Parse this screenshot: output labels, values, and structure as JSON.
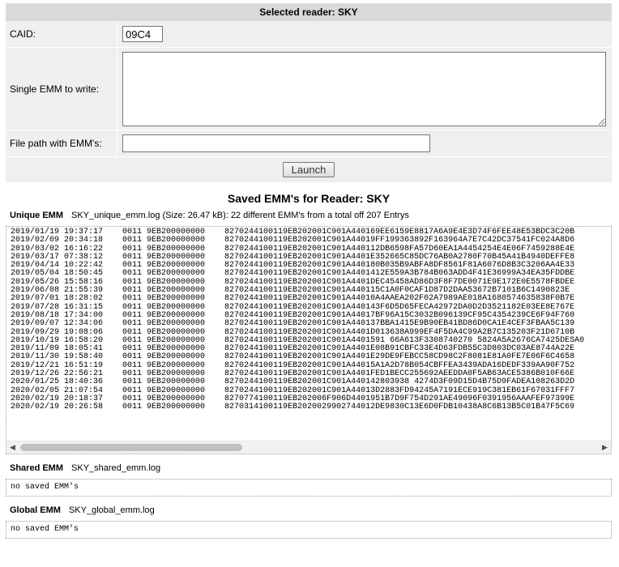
{
  "header": {
    "title": "Selected reader: SKY"
  },
  "form": {
    "caid_label": "CAID:",
    "caid_value": "09C4",
    "single_emm_label": "Single EMM to write:",
    "single_emm_value": "",
    "file_path_label": "File path with EMM's:",
    "file_path_value": "",
    "launch_label": "Launch"
  },
  "saved": {
    "title": "Saved EMM's for Reader: SKY",
    "unique": {
      "heading": "Unique EMM",
      "info": "SKY_unique_emm.log (Size: 26.47 kB): 22 different EMM's from a total off 207 Entrys",
      "lines": [
        "2019/01/19 19:37:17    0011 9EB200000000    8270244100119EB202001C901A440169EE6159E8817A6A9E4E3D74F6FEE48E53BDC3C20B",
        "2019/02/09 20:34:18    0011 9EB200000000    8270244100119EB202001C901A44019FF199363892F163964A7E7C42DC37541FC024A8D6",
        "2019/03/02 16:16:22    0011 9EB200000000    8270244100119EB202001C901A440112DB6598FA57D60EA1A4454254E4E06F7459288E4E",
        "2019/03/17 07:38:12    0011 9EB200000000    8270244100119EB202001C901A4401E352665C85DC76AB0A2780F70B45A41B4940DEFFE8",
        "2019/04/14 10:22:42    0011 9EB200000000    8270244100119EB202001C901A440180B035B9ABFA8DF8561F81A6076D8B3C3206AA4E33",
        "2019/05/04 18:50:45    0011 9EB200000000    8270244100119EB202001C901A4401412E559A3B784B063ADD4F41E36999A34EA35FDDBE",
        "2019/05/26 15:58:16    0011 9EB200000000    8270244100119EB202001C901A4401DEC45458AD86D3F8F7DE0071E9E172E0E5578FBDEE",
        "2019/06/08 21:55:39    0011 9EB200000000    8270244100119EB202001C901A440115C1A0F0CAF1D87D2DAA53672B7101B6C1490823E",
        "2019/07/01 18:28:02    0011 9EB200000000    8270244100119EB202001C901A44010A4AAEA202F02A7989AE018A1680574635838F0B7E",
        "2019/07/28 16:31:15    0011 9EB200000000    8270244100119EB202001C901A440143F6D5D65FECA42972DA0D2D3521182E03EE8E767E",
        "2019/08/18 17:34:00    0011 9EB200000000    8270244100119EB202001C901A44017BF96A15C3032B096139CF95C4354239CE6F94F760",
        "2019/09/07 12:34:06    0011 9EB200000000    8270244100119EB202001C901A440137BBA1415E9B90EB41BD86D0CA1E4CEF3FBAA5C139",
        "2019/09/29 19:08:06    0011 9EB200000000    8270244100119EB202001C901A4401D013638A999EF4F5DA4C99A2B7C135203F21D6710B",
        "2019/10/19 16:58:20    0011 9EB200000000    8270244100119EB202001C901A4401591 66A613F3308740270 5824A5A2676CA7425DESA0",
        "2019/11/09 18:05:41    0011 9EB200000000    8270244100119EB202001C901A4401E08B91CBFC33E4D63FDB55C3D803DC03AE8744A22E",
        "2019/11/30 19:58:40    0011 9EB200000000    8270244100119EB202001C901A4401E29DE9FEBCC58CD98C2F8081E81A0FE7E06F6C4658",
        "2019/12/21 16:51:19    0011 9EB200000000    8270244100119EB202001C901A44015A1A2D78B054CBFFEA3439ADA16DEDF339AA90F752",
        "2019/12/26 22:56:21    0011 9EB200000000    8270244100119EB202001C901A4401FED1BECC255692AEEDDA0F5AB63ACE5386B010F66E",
        "2020/01/25 18:40:36    0011 9EB200000000    8270244100119EB202001C901A440142803938 4274D3F09D15D4B75D9FADEA108263D2D",
        "2020/02/05 21:07:54    0011 9EB200000000    8270244100119EB202001C901A44013D2883FD94245A7191ECE919C381EB61F67031FFF7",
        "2020/02/19 20:18:37    0011 9EB200000000    8270774100119EB202006F906D4401951B7D9F754D291AE49096F0391956AAAFEF97399E",
        "2020/02/19 20:26:58    0011 9EB200000000    8270314100119EB2020029902744012DE9830C13E6D0FDB10438A8C6B13B5C01B47F5C69"
      ]
    },
    "shared": {
      "heading": "Shared EMM",
      "info": "SKY_shared_emm.log",
      "empty_text": "no saved EMM's"
    },
    "global": {
      "heading": "Global EMM",
      "info": "SKY_global_emm.log",
      "empty_text": "no saved EMM's"
    }
  },
  "icons": {
    "scroll_left": "triangle-left-icon",
    "scroll_right": "triangle-right-icon"
  }
}
